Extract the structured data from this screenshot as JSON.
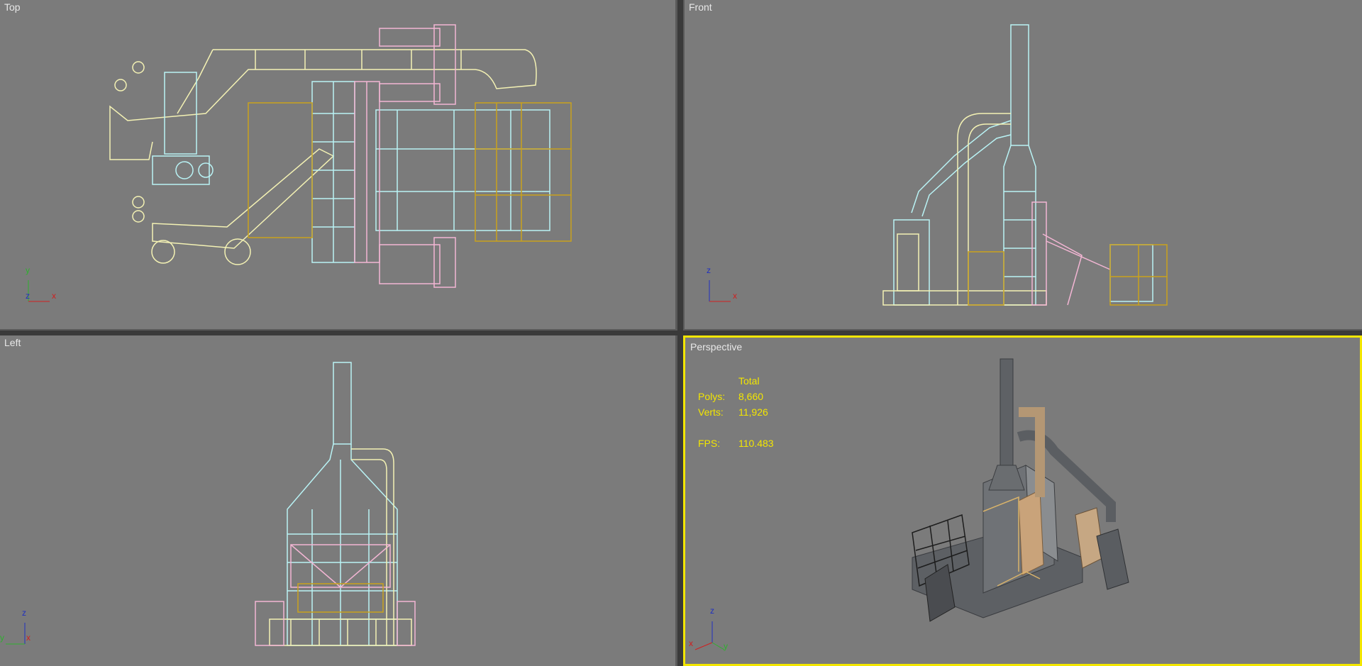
{
  "viewports": {
    "top": {
      "label": "Top",
      "axis": {
        "a": "y",
        "b": "x",
        "c": "z"
      }
    },
    "front": {
      "label": "Front",
      "axis": {
        "a": "z",
        "b": "x"
      }
    },
    "left": {
      "label": "Left",
      "axis": {
        "a": "z",
        "b": "y",
        "c": "x"
      }
    },
    "perspective": {
      "label": "Perspective",
      "axis": {
        "a": "z",
        "b": "x",
        "c": "y"
      },
      "stats": {
        "header": "Total",
        "polys_label": "Polys:",
        "polys": "8,660",
        "verts_label": "Verts:",
        "verts": "11,926",
        "fps_label": "FPS:",
        "fps": "110.483"
      }
    }
  },
  "colors": {
    "viewport_bg": "#7b7b7b",
    "active_border": "#f3e600",
    "wire_yellow": "#f4f2b4",
    "wire_cyan": "#b9f3f5",
    "wire_pink": "#f3b6d4",
    "wire_gold": "#c9a21d"
  }
}
